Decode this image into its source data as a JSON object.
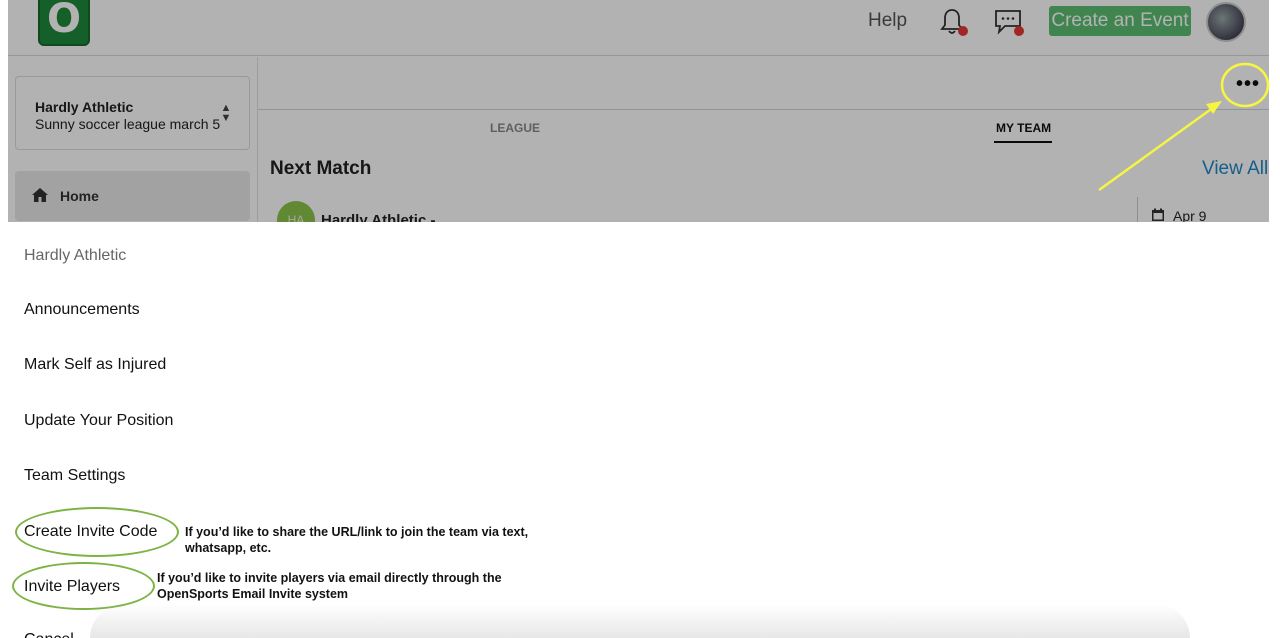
{
  "header": {
    "logo_letter": "O",
    "help_label": "Help",
    "create_event_label": "Create an Event"
  },
  "sidebar": {
    "team_name": "Hardly Athletic",
    "league_name": "Sunny soccer league march 5",
    "home_label": "Home"
  },
  "main": {
    "tabs": [
      {
        "label": "LEAGUE"
      },
      {
        "label": "MY TEAM"
      }
    ],
    "next_match_title": "Next Match",
    "view_all_label": "View All",
    "match": {
      "team_initials": "HA",
      "team_name": "Hardly Athletic -",
      "date": "Apr 9"
    }
  },
  "action_sheet": {
    "header": "Hardly Athletic",
    "items": [
      {
        "label": "Announcements"
      },
      {
        "label": "Mark Self as Injured"
      },
      {
        "label": "Update Your Position"
      },
      {
        "label": "Team Settings"
      },
      {
        "label": "Create Invite Code"
      },
      {
        "label": "Invite Players"
      },
      {
        "label": "Cancel"
      }
    ]
  },
  "annotations": {
    "invite_code_note": "If you’d like to share the URL/link to join  the team via text, whatsapp, etc.",
    "invite_players_note": "If you’d like to invite players via email directly through the OpenSports Email Invite system"
  },
  "colors": {
    "brand_green": "#1f8a3a",
    "create_event_bg": "#5cbf72",
    "link_blue": "#1e88c8",
    "annotation_yellow": "#f5f542",
    "annotation_green": "#7cb342",
    "notification_red": "#e53935"
  }
}
